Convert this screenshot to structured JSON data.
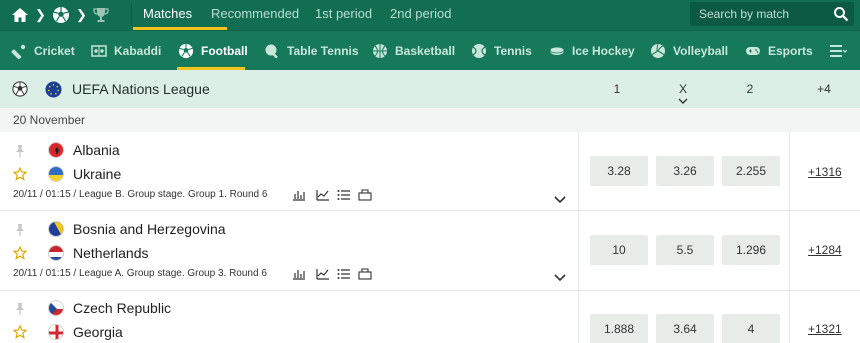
{
  "topbar": {
    "icons": [
      "home-icon",
      "soccer-ball-icon",
      "trophy-icon"
    ],
    "tabs": [
      {
        "label": "Matches",
        "active": true
      },
      {
        "label": "Recommended",
        "active": false
      },
      {
        "label": "1st period",
        "active": false
      },
      {
        "label": "2nd period",
        "active": false
      }
    ],
    "search_placeholder": "Search by match"
  },
  "sports": [
    {
      "label": "Cricket",
      "icon": "cricket-icon",
      "active": false
    },
    {
      "label": "Kabaddi",
      "icon": "kabaddi-icon",
      "active": false
    },
    {
      "label": "Football",
      "icon": "soccer-ball-icon",
      "active": true
    },
    {
      "label": "Table Tennis",
      "icon": "table-tennis-icon",
      "active": false
    },
    {
      "label": "Basketball",
      "icon": "basketball-icon",
      "active": false
    },
    {
      "label": "Tennis",
      "icon": "tennis-icon",
      "active": false
    },
    {
      "label": "Ice Hockey",
      "icon": "ice-hockey-icon",
      "active": false
    },
    {
      "label": "Volleyball",
      "icon": "volleyball-icon",
      "active": false
    },
    {
      "label": "Esports",
      "icon": "gamepad-icon",
      "active": false
    }
  ],
  "league": {
    "name": "UEFA Nations League",
    "col1": "1",
    "colx": "X",
    "col2": "2",
    "col_more": "+4"
  },
  "date": "20 November",
  "matches": [
    {
      "home": "Albania",
      "away": "Ukraine",
      "meta": "20/11 / 01:15 / League B. Group stage. Group 1. Round 6",
      "odds": [
        "3.28",
        "3.26",
        "2.255"
      ],
      "more": "+1316"
    },
    {
      "home": "Bosnia and Herzegovina",
      "away": "Netherlands",
      "meta": "20/11 / 01:15 / League A. Group stage. Group 3. Round 6",
      "odds": [
        "10",
        "5.5",
        "1.296"
      ],
      "more": "+1284"
    },
    {
      "home": "Czech Republic",
      "away": "Georgia",
      "meta": "",
      "odds": [
        "1.888",
        "3.64",
        "4"
      ],
      "more": "+1321"
    }
  ],
  "colors": {
    "topbar": "#126e51",
    "sportsbar": "#16795a",
    "accent": "#f3c41e",
    "league_bg": "#dcefe6"
  }
}
